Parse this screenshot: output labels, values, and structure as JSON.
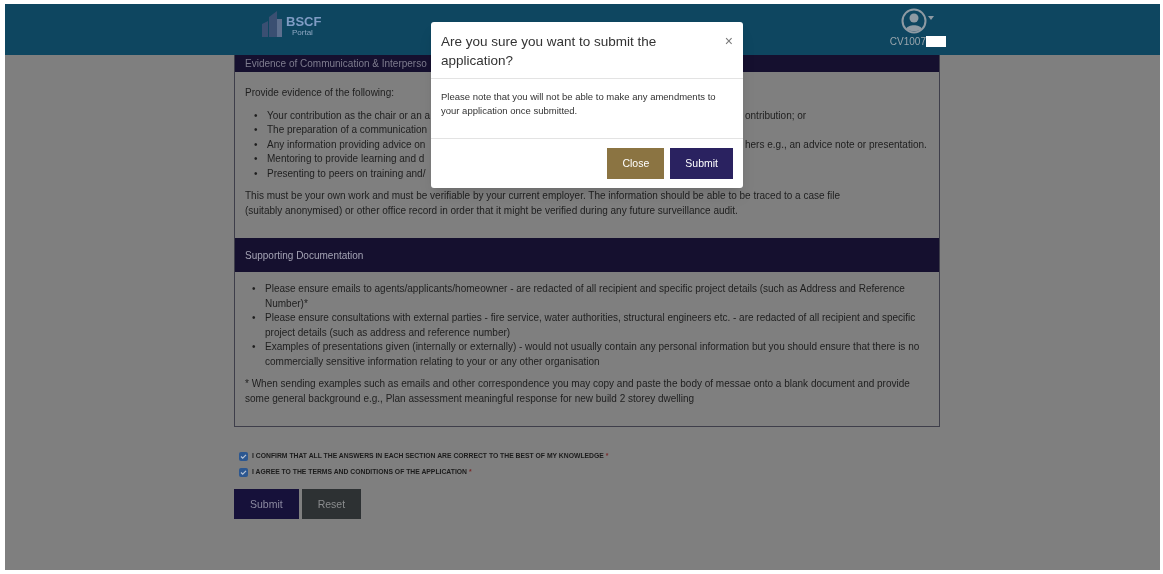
{
  "header": {
    "logo": {
      "name": "BSCF",
      "subtitle": "Portal"
    },
    "user": {
      "id": "CV1007"
    }
  },
  "evidence_section": {
    "title": "Evidence of Communication & Interperso",
    "intro": "Provide evidence of the following:",
    "bullets": [
      {
        "bullet": "•",
        "left": "Your contribution as the chair or an a",
        "right": "ontribution; or"
      },
      {
        "bullet": "•",
        "left": "The preparation of a communication"
      },
      {
        "bullet": "•",
        "left": "Any information providing advice on",
        "right": "hers e.g., an advice note or presentation."
      },
      {
        "bullet": "•",
        "left": "Mentoring to provide learning and d"
      },
      {
        "bullet": "•",
        "left": "Presenting to peers on training and/"
      }
    ],
    "note": "This must be your own work and must be verifiable by your current employer. The information should be able to be traced to a case file (suitably anonymised) or other office record in order that it might be verified during any future surveillance audit."
  },
  "supporting_section": {
    "title": "Supporting Documentation",
    "bullets": [
      {
        "bullet": "•",
        "text": "Please ensure emails to agents/applicants/homeowner - are redacted of all recipient and specific project details (such as Address and Reference Number)*"
      },
      {
        "bullet": "•",
        "text": "Please ensure consultations with external parties - fire service, water authorities, structural engineers etc. - are redacted of all recipient and specific project details (such as address and reference number)"
      },
      {
        "bullet": "•",
        "text": "Examples of presentations given (internally or externally) - would not usually contain any personal information but you should ensure that there is no commercially sensitive information relating to your or any other organisation"
      }
    ],
    "note": "* When sending examples such as emails and other correspondence you may copy and paste the body of messae onto a blank document and provide some general background e.g., Plan assessment meaningful response for new build 2 storey dwelling"
  },
  "declarations": [
    {
      "label": "I CONFIRM THAT ALL THE ANSWERS IN EACH SECTION ARE CORRECT TO THE BEST OF MY KNOWLEDGE",
      "required": "*",
      "checked": true
    },
    {
      "label": "I AGREE TO THE TERMS AND CONDITIONS OF THE APPLICATION",
      "required": "*",
      "checked": true
    }
  ],
  "form_buttons": [
    "Submit",
    "Reset"
  ],
  "modal": {
    "title": "Are you sure you want to submit the application?",
    "close_glyph": "×",
    "body": "Please note that you will not be able to make any amendments to your application once submitted.",
    "buttons": [
      "Close",
      "Submit"
    ]
  }
}
